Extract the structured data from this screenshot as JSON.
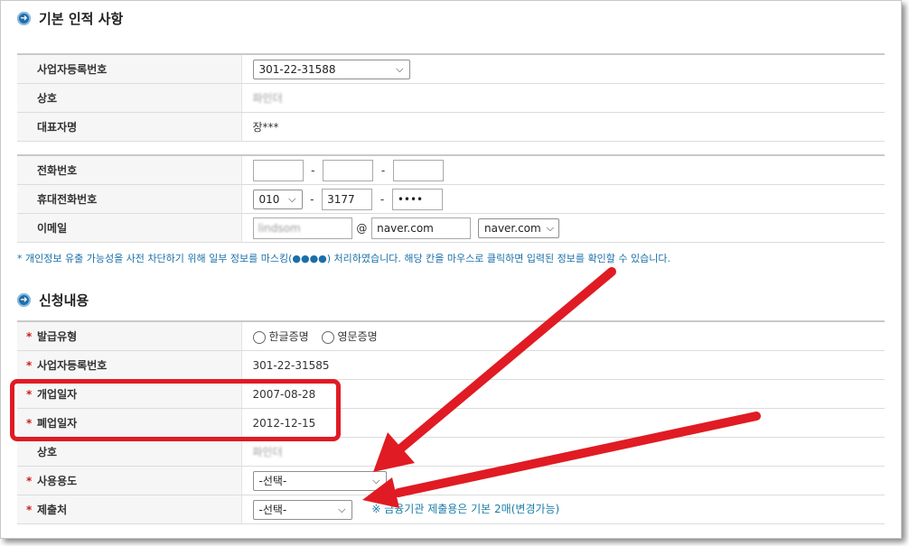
{
  "section_basic": {
    "title": "기본 인적 사항",
    "rows": {
      "biz_no_label": "사업자등록번호",
      "biz_no_value": "301-22-31588",
      "company_label": "상호",
      "company_value": "파인더",
      "ceo_label": "대표자명",
      "ceo_value": "장***"
    },
    "contact": {
      "phone_label": "전화번호",
      "phone_parts": [
        "",
        "",
        ""
      ],
      "mobile_label": "휴대전화번호",
      "mobile_prefix": "010",
      "mobile_mid": "3177",
      "mobile_last": "••••",
      "email_label": "이메일",
      "email_id": "lindsom",
      "email_at": "@",
      "email_domain": "naver.com",
      "email_domain_select": "naver.com"
    },
    "dash": "-"
  },
  "notice": "* 개인정보 유출 가능성을 사전 차단하기 위해 일부 정보를 마스킹(●●●●) 처리하였습니다. 해당 칸을 마우스로 클릭하면 입력된 정보를 확인할 수 있습니다.",
  "section_request": {
    "title": "신청내용",
    "req_mark": "*",
    "issue_type_label": "발급유형",
    "issue_type_options": [
      "한글증명",
      "영문증명"
    ],
    "biz_no_label": "사업자등록번호",
    "biz_no_value": "301-22-31585",
    "open_date_label": "개업일자",
    "open_date_value": "2007-08-28",
    "close_date_label": "폐업일자",
    "close_date_value": "2012-12-15",
    "company_label": "상호",
    "company_value": "파인더",
    "usage_label": "사용용도",
    "usage_value": "-선택-",
    "submit_label": "제출처",
    "submit_value": "-선택-",
    "submit_hint": "※ 금융기관 제출용은 기본 2매(변경가능)"
  },
  "icons": {
    "bullet": "arrow-circle-icon",
    "chevron": "chevron-down-icon"
  },
  "colors": {
    "accent": "#1f6ea8",
    "annotation": "#e01b23",
    "required": "#d01c1c"
  }
}
